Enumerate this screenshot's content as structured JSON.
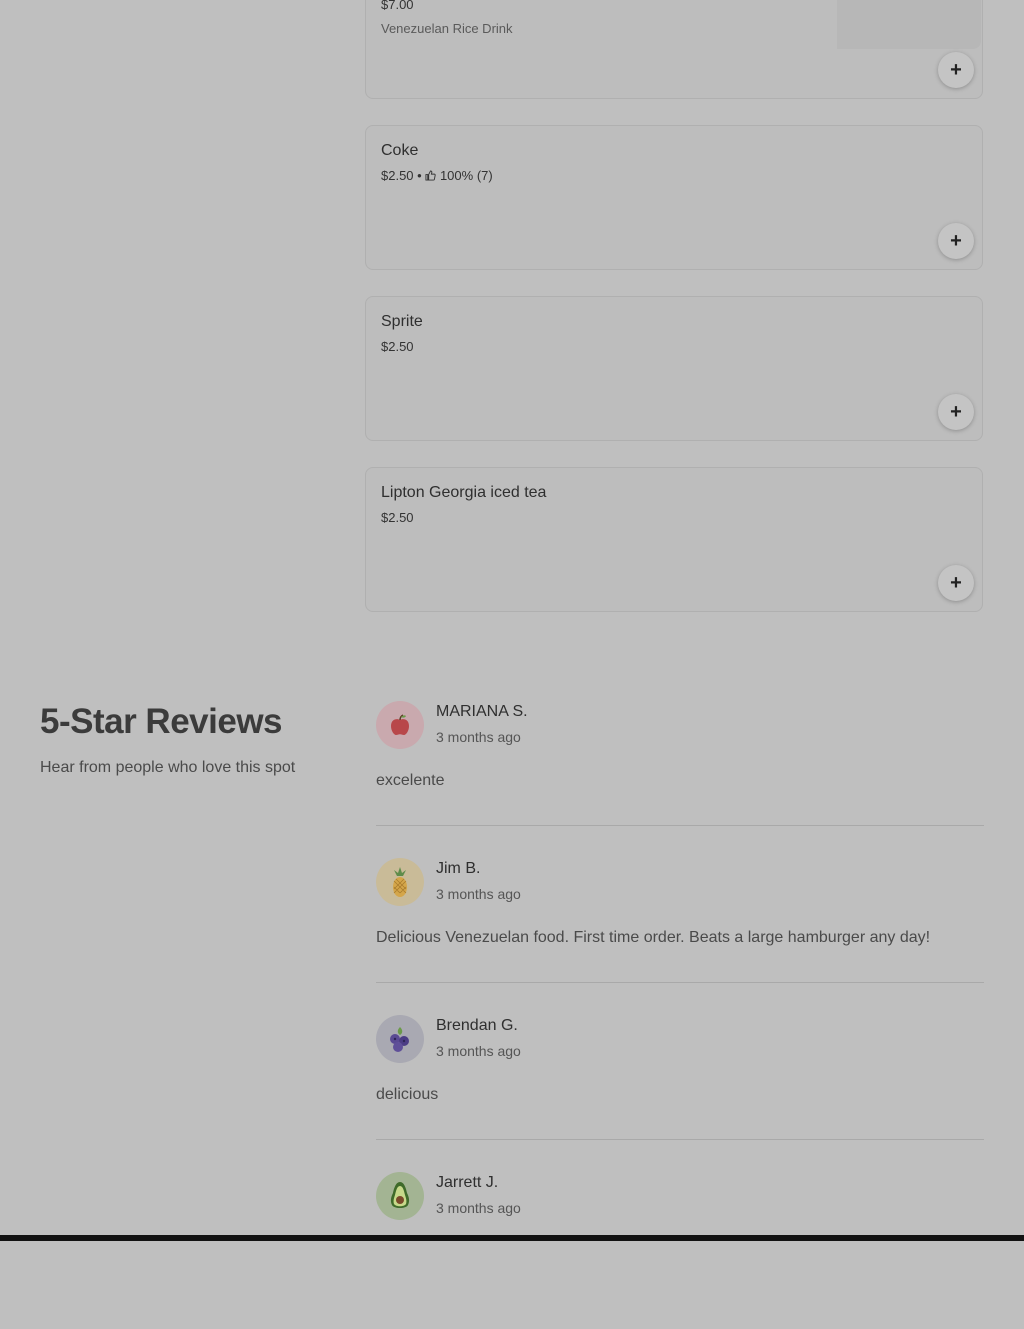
{
  "menu": {
    "partial_item": {
      "price": "$7.00",
      "description": "Venezuelan Rice Drink",
      "add_icon": "plus-icon"
    },
    "items": [
      {
        "name": "Coke",
        "price": "$2.50",
        "separator": " • ",
        "rating_icon": "thumbs-up-icon",
        "rating": "100% (7)"
      },
      {
        "name": "Sprite",
        "price": "$2.50"
      },
      {
        "name": "Lipton Georgia iced tea",
        "price": "$2.50"
      }
    ],
    "add_label": "+"
  },
  "reviews": {
    "title": "5-Star Reviews",
    "subtitle": "Hear from people who love this spot",
    "list": [
      {
        "name": "MARIANA S.",
        "time": "3 months ago",
        "text": "excelente",
        "avatar_icon": "apple-icon",
        "avatar_bg": "#c9a9ae"
      },
      {
        "name": "Jim B.",
        "time": "3 months ago",
        "text": "Delicious Venezuelan food. First time order. Beats a large hamburger any day!",
        "avatar_icon": "pineapple-icon",
        "avatar_bg": "#c9bb98"
      },
      {
        "name": "Brendan G.",
        "time": "3 months ago",
        "text": "delicious",
        "avatar_icon": "blueberries-icon",
        "avatar_bg": "#a9a9b2"
      },
      {
        "name": "Jarrett J.",
        "time": "3 months ago",
        "text": "",
        "avatar_icon": "avocado-icon",
        "avatar_bg": "#a3b493"
      }
    ]
  }
}
